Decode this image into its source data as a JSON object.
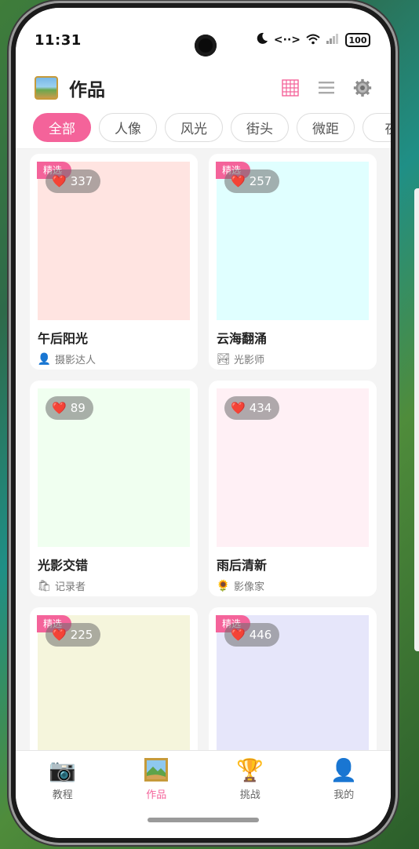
{
  "status": {
    "time": "11:31",
    "battery": "100"
  },
  "header": {
    "title": "作品",
    "logo_icon": "landscape-picture-icon"
  },
  "tabs": [
    {
      "label": "全部",
      "active": true
    },
    {
      "label": "人像",
      "active": false
    },
    {
      "label": "风光",
      "active": false
    },
    {
      "label": "街头",
      "active": false
    },
    {
      "label": "微距",
      "active": false
    },
    {
      "label": "夜",
      "active": false
    }
  ],
  "works": [
    {
      "featured_label": "精选",
      "likes": "337",
      "title": "午后阳光",
      "author": "摄影达人",
      "avatar": "👤",
      "bg": "#ffe4e1"
    },
    {
      "featured_label": "精选",
      "likes": "257",
      "title": "云海翻涌",
      "author": "光影师",
      "avatar": "🏞",
      "bg": "#e0ffff"
    },
    {
      "featured_label": "",
      "likes": "89",
      "title": "光影交错",
      "author": "记录者",
      "avatar": "🛍",
      "bg": "#f0fff0"
    },
    {
      "featured_label": "",
      "likes": "434",
      "title": "雨后清新",
      "author": "影像家",
      "avatar": "🌻",
      "bg": "#fff0f5"
    },
    {
      "featured_label": "精选",
      "likes": "225",
      "title": "",
      "author": "",
      "avatar": "",
      "bg": "#f5f5dc"
    },
    {
      "featured_label": "精选",
      "likes": "446",
      "title": "",
      "author": "",
      "avatar": "",
      "bg": "#e6e6fa"
    }
  ],
  "nav": [
    {
      "label": "教程",
      "icon": "📷",
      "active": false,
      "name": "nav-tutorial"
    },
    {
      "label": "作品",
      "icon": "",
      "active": true,
      "name": "nav-works"
    },
    {
      "label": "挑战",
      "icon": "🏆",
      "active": false,
      "name": "nav-challenge"
    },
    {
      "label": "我的",
      "icon": "👤",
      "active": false,
      "name": "nav-mine"
    }
  ],
  "colors": {
    "accent": "#f4639a"
  }
}
